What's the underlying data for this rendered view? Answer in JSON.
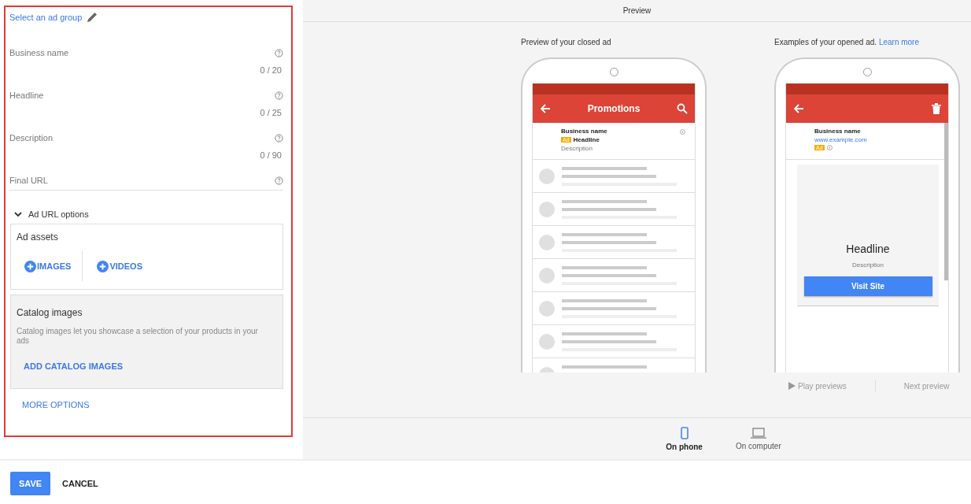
{
  "ad_group_link": "Select an ad group",
  "fields": [
    {
      "label": "Business name",
      "counter": "0 / 20"
    },
    {
      "label": "Headline",
      "counter": "0 / 25"
    },
    {
      "label": "Description",
      "counter": "0 / 90"
    },
    {
      "label": "Final URL"
    }
  ],
  "url_options": "Ad URL options",
  "ad_assets": {
    "title": "Ad assets",
    "buttons": [
      "IMAGES",
      "VIDEOS"
    ]
  },
  "catalog": {
    "title": "Catalog images",
    "description": "Catalog images let you showcase a selection of your products in your ads",
    "action": "ADD CATALOG IMAGES"
  },
  "more_options": "MORE OPTIONS",
  "preview": {
    "title": "Preview",
    "closed": {
      "caption": "Preview of your closed ad",
      "app_title": "Promotions",
      "business_name": "Business name",
      "ad_badge": "Ad",
      "headline": "Headline",
      "description": "Description"
    },
    "opened": {
      "caption": "Examples of your opened ad.",
      "link": "Learn more",
      "business_name": "Business name",
      "url": "www.example.com",
      "ad_badge": "Ad",
      "headline": "Headline",
      "description": "Description",
      "cta": "Visit Site"
    },
    "play": "Play previews",
    "next": "Next preview",
    "devices": [
      {
        "kind": "phone",
        "label": "On phone",
        "selected": true
      },
      {
        "kind": "computer",
        "label": "On computer",
        "selected": false
      }
    ]
  },
  "actions": {
    "save": "SAVE",
    "cancel": "CANCEL"
  }
}
